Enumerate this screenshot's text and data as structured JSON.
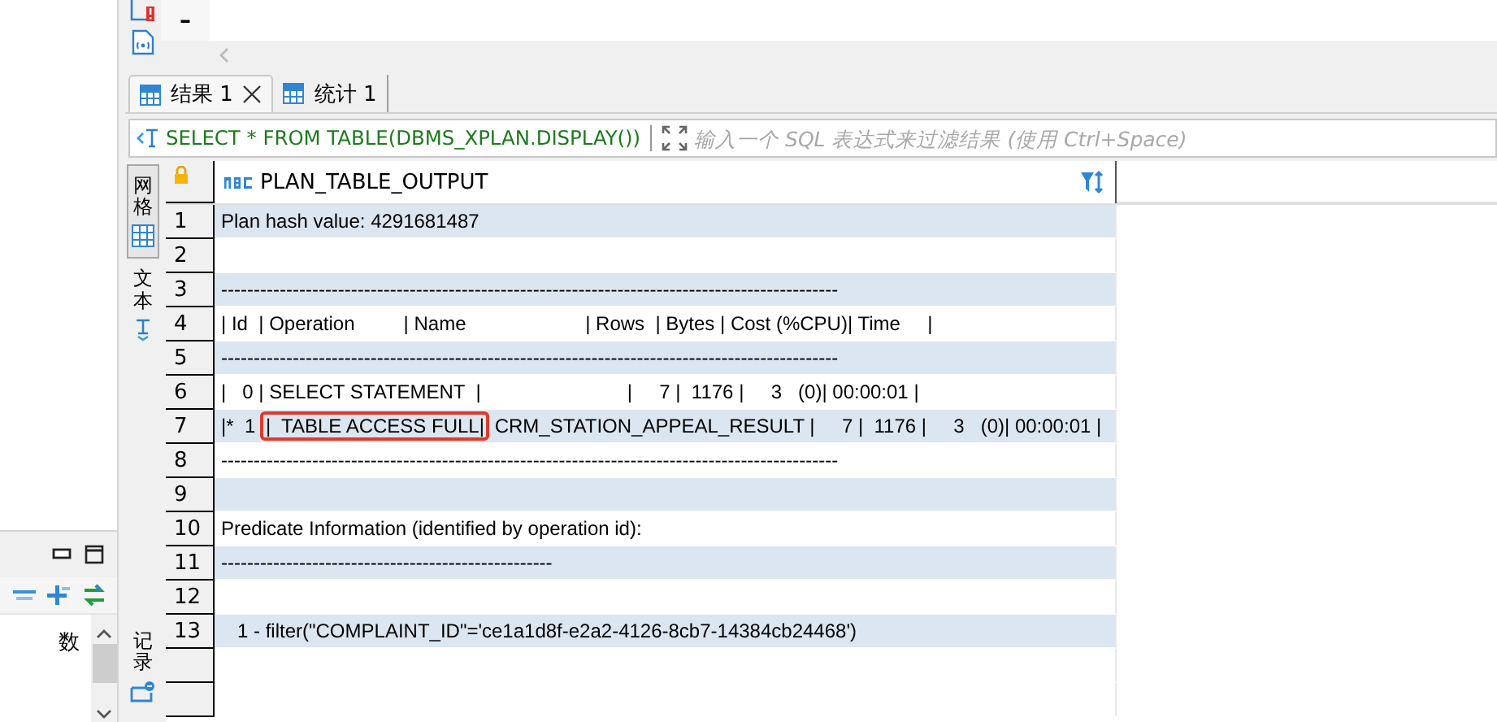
{
  "left_panel": {
    "items": [
      "数"
    ]
  },
  "editor": {
    "text": "–"
  },
  "result_tabs": [
    {
      "label": "结果 1",
      "selected": true,
      "closable": true
    },
    {
      "label": "统计 1",
      "selected": false,
      "closable": false
    }
  ],
  "filter": {
    "query": "SELECT * FROM TABLE(DBMS_XPLAN.DISPLAY())",
    "placeholder": "输入一个 SQL 表达式来过滤结果 (使用 Ctrl+Space)"
  },
  "view_tabs": [
    {
      "label": "网格",
      "selected": true
    },
    {
      "label": "文本",
      "selected": false
    }
  ],
  "record_toggle": {
    "label": "记录"
  },
  "table": {
    "columns": [
      {
        "label": "PLAN_TABLE_OUTPUT"
      }
    ],
    "rows": [
      {
        "num": "1",
        "parts": [
          {
            "text": "Plan hash value: 4291681487",
            "boxed": false
          }
        ]
      },
      {
        "num": "2"
      },
      {
        "num": "3",
        "parts": [
          {
            "text": "-----------------------------------------------------------------------------------------------",
            "boxed": false
          }
        ]
      },
      {
        "num": "4",
        "parts": [
          {
            "text": "| Id  | Operation         | Name                      | Rows  | Bytes | Cost (%CPU)| Time     |",
            "boxed": false
          }
        ]
      },
      {
        "num": "5",
        "parts": [
          {
            "text": "-----------------------------------------------------------------------------------------------",
            "boxed": false
          }
        ]
      },
      {
        "num": "6",
        "parts": [
          {
            "text": "|   0 | SELECT STATEMENT  |                           |     7 |  1176 |     3   (0)| 00:00:01 |",
            "boxed": false
          }
        ]
      },
      {
        "num": "7",
        "parts": [
          {
            "text": "|*  1 ",
            "boxed": false
          },
          {
            "text": "|  TABLE ACCESS FULL|",
            "boxed": true
          },
          {
            "text": " CRM_STATION_APPEAL_RESULT |     7 |  1176 |     3   (0)| 00:00:01 |",
            "boxed": false
          }
        ]
      },
      {
        "num": "8",
        "parts": [
          {
            "text": "-----------------------------------------------------------------------------------------------",
            "boxed": false
          }
        ]
      },
      {
        "num": "9"
      },
      {
        "num": "10",
        "parts": [
          {
            "text": "Predicate Information (identified by operation id):",
            "boxed": false
          }
        ]
      },
      {
        "num": "11",
        "parts": [
          {
            "text": "---------------------------------------------------",
            "boxed": false
          }
        ]
      },
      {
        "num": "12"
      },
      {
        "num": "13",
        "parts": [
          {
            "text": "   1 - filter(\"COMPLAINT_ID\"='ce1a1d8f-e2a2-4126-8cb7-14384cb24468')",
            "boxed": false
          }
        ]
      }
    ]
  }
}
